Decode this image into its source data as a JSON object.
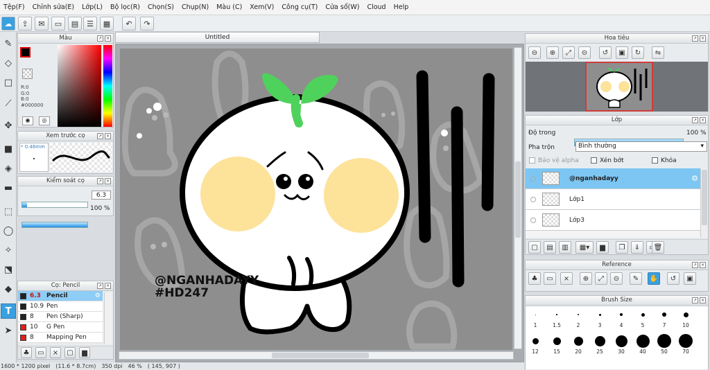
{
  "menu": [
    "Tệp(F)",
    "Chỉnh sửa(E)",
    "Lớp(L)",
    "Bộ lọc(R)",
    "Chọn(S)",
    "Chụp(N)",
    "Màu (C)",
    "Xem(V)",
    "Công cụ(T)",
    "Cửa sổ(W)",
    "Cloud",
    "Help"
  ],
  "document": {
    "tab_title": "Untitled"
  },
  "color_panel": {
    "title": "Màu",
    "r": "R:0",
    "g": "G:0",
    "b": "B:0",
    "hex": "#000000"
  },
  "brush_preview": {
    "title": "Xem trước cọ",
    "size": "* 0.46mm"
  },
  "brush_control": {
    "title": "Kiểm soát cọ",
    "size_value": "6.3",
    "size_fraction": 0.07,
    "opacity_value": "100 %",
    "opacity_fraction": 1.0
  },
  "brush_list": {
    "title": "Cọ: Pencil",
    "items": [
      {
        "size": "6.3",
        "name": "Pencil",
        "color": "#222222",
        "selected": true
      },
      {
        "size": "10.9",
        "name": "Pen",
        "color": "#222222"
      },
      {
        "size": "8",
        "name": "Pen (Sharp)",
        "color": "#222222"
      },
      {
        "size": "10",
        "name": "G Pen",
        "color": "#e02020"
      },
      {
        "size": "8",
        "name": "Mapping Pen",
        "color": "#e02020"
      }
    ]
  },
  "navigator": {
    "title": "Hoa tiêu"
  },
  "layer_panel": {
    "title": "Lớp",
    "opacity_label": "Độ trong",
    "opacity_value": "100 %",
    "opacity_fraction": 1.0,
    "blend_label": "Pha trộn",
    "blend_value": "Bình thường",
    "protect_alpha": "Bảo vệ alpha",
    "clipping": "Xén bớt",
    "lock": "Khóa",
    "layers": [
      {
        "name": "@nganhadayy",
        "selected": true
      },
      {
        "name": "Lớp1"
      },
      {
        "name": "Lớp3"
      }
    ]
  },
  "reference": {
    "title": "Reference"
  },
  "brush_size": {
    "title": "Brush Size",
    "row1": [
      "1",
      "1.5",
      "2",
      "3",
      "4",
      "5",
      "7",
      "10"
    ],
    "row2": [
      "12",
      "15",
      "20",
      "25",
      "30",
      "40",
      "50",
      "70"
    ]
  },
  "artwork": {
    "text_line1": "@NGANHADAYY",
    "text_line2": "#HD247"
  },
  "status": {
    "canvas_size": "1600 * 1200 pixel",
    "physical_size": "(11.6 * 8.7cm)",
    "dpi": "350 dpi",
    "zoom": "46 %",
    "cursor": "( 145, 907 )"
  },
  "colors": {
    "accent": "#3aa0e0",
    "selected_row": "#7dc6f3",
    "canvas_bg": "#8e8e8e",
    "leaf": "#4fd25c",
    "cheek": "#fde29a"
  }
}
